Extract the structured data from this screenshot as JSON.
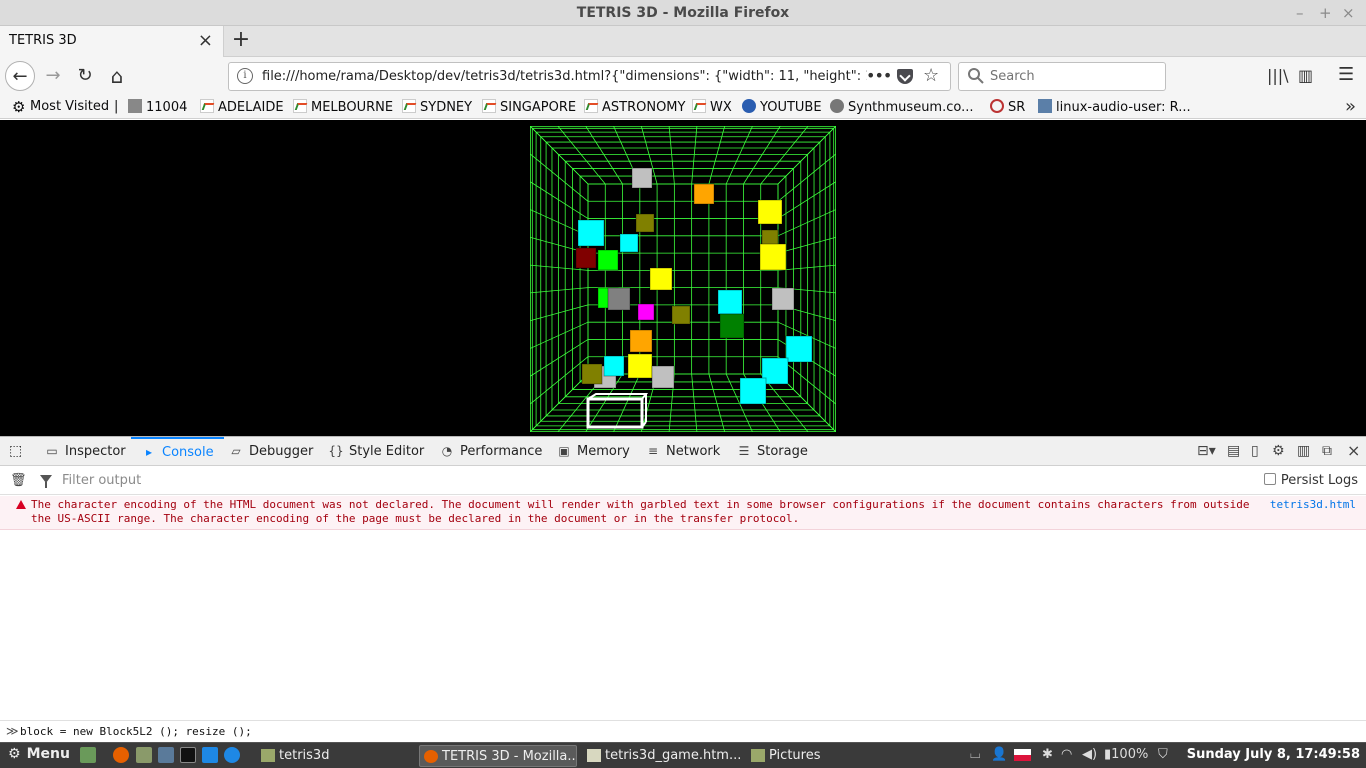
{
  "window": {
    "title": "TETRIS 3D - Mozilla Firefox",
    "controls": [
      "–",
      "+",
      "×"
    ]
  },
  "tabs": [
    {
      "label": "TETRIS 3D",
      "close": "×"
    }
  ],
  "new_tab": "+",
  "nav": {
    "back": "←",
    "forward": "→",
    "reload": "↻",
    "home": "⌂",
    "url": "file:///home/rama/Desktop/dev/tetris3d/tetris3d.html?{\"dimensions\": {\"width\": 11, \"height\": 1",
    "info": "i",
    "page_actions": "•••",
    "bookmark_star": "☆",
    "search_placeholder": "Search",
    "library": "|||\\",
    "sidebar": "▥",
    "menu": "☰"
  },
  "bookmarks": [
    {
      "label": "Most Visited",
      "icon": "gear-icon"
    },
    {
      "label": "11004",
      "icon": "page-icon"
    },
    {
      "label": "ADELAIDE",
      "icon": "weather-icon"
    },
    {
      "label": "MELBOURNE",
      "icon": "weather-icon"
    },
    {
      "label": "SYDNEY",
      "icon": "weather-icon"
    },
    {
      "label": "SINGAPORE",
      "icon": "weather-icon"
    },
    {
      "label": "ASTRONOMY",
      "icon": "weather-icon"
    },
    {
      "label": "WX",
      "icon": "weather-icon"
    },
    {
      "label": "YOUTUBE",
      "icon": "youtube-icon"
    },
    {
      "label": "Synthmuseum.co...",
      "icon": "synth-icon"
    },
    {
      "label": "SR",
      "icon": "sr-icon"
    },
    {
      "label": "linux-audio-user: R...",
      "icon": "linux-icon"
    }
  ],
  "bookmarks_separator": "|",
  "bookmarks_overflow": "»",
  "game": {
    "background": "#000000",
    "grid_color": "#3cff3c",
    "blocks": [
      {
        "color": "#c0c0c0"
      },
      {
        "color": "#ffa500"
      },
      {
        "color": "#ffff00"
      },
      {
        "color": "#808000"
      },
      {
        "color": "#00ffff"
      },
      {
        "color": "#00ffff"
      },
      {
        "color": "#800000"
      },
      {
        "color": "#00ff00"
      },
      {
        "color": "#808000"
      },
      {
        "color": "#ffff00"
      },
      {
        "color": "#ffff00"
      },
      {
        "color": "#00ff00"
      },
      {
        "color": "#808080"
      },
      {
        "color": "#ff00ff"
      },
      {
        "color": "#808000"
      },
      {
        "color": "#00ffff"
      },
      {
        "color": "#008000"
      },
      {
        "color": "#c0c0c0"
      },
      {
        "color": "#ffa500"
      },
      {
        "color": "#00ffff"
      },
      {
        "color": "#00ffff"
      },
      {
        "color": "#ffff00"
      },
      {
        "color": "#00ffff"
      },
      {
        "color": "#c0c0c0"
      },
      {
        "color": "#c0c0c0"
      },
      {
        "color": "#00ffff"
      },
      {
        "color": "#808000"
      }
    ]
  },
  "devtools": {
    "tabs": [
      {
        "label": "Inspector",
        "icon": "inspector-icon",
        "glyph": "▭"
      },
      {
        "label": "Console",
        "icon": "console-icon",
        "glyph": "▸",
        "active": true
      },
      {
        "label": "Debugger",
        "icon": "debugger-icon",
        "glyph": "▱"
      },
      {
        "label": "Style Editor",
        "icon": "style-editor-icon",
        "glyph": "{}"
      },
      {
        "label": "Performance",
        "icon": "performance-icon",
        "glyph": "◔"
      },
      {
        "label": "Memory",
        "icon": "memory-icon",
        "glyph": "▣"
      },
      {
        "label": "Network",
        "icon": "network-icon",
        "glyph": "≡"
      },
      {
        "label": "Storage",
        "icon": "storage-icon",
        "glyph": "☰"
      }
    ],
    "picker": "⬚",
    "trash": "🗑",
    "filter_placeholder": "Filter output",
    "persist_logs": "Persist Logs",
    "error_message": "The character encoding of the HTML document was not declared. The document will render with garbled text in some browser configurations if the document contains characters from outside the US-ASCII range. The character encoding of the page must be declared in the document or in the transfer protocol.",
    "error_source": "tetris3d.html",
    "prompt": "≫",
    "input_value": "block = new Block5L2 (); resize ();"
  },
  "taskbar": {
    "menu_label": "Menu",
    "windows": [
      {
        "label": "tetris3d",
        "icon": "folder-icon"
      },
      {
        "label": "TETRIS 3D - Mozilla...",
        "icon": "firefox-icon",
        "active": true
      },
      {
        "label": "tetris3d_game.htm...",
        "icon": "text-editor-icon"
      },
      {
        "label": "Pictures",
        "icon": "folder-icon"
      }
    ],
    "battery": "100%",
    "clock": "Sunday July  8, 17:49:58"
  }
}
